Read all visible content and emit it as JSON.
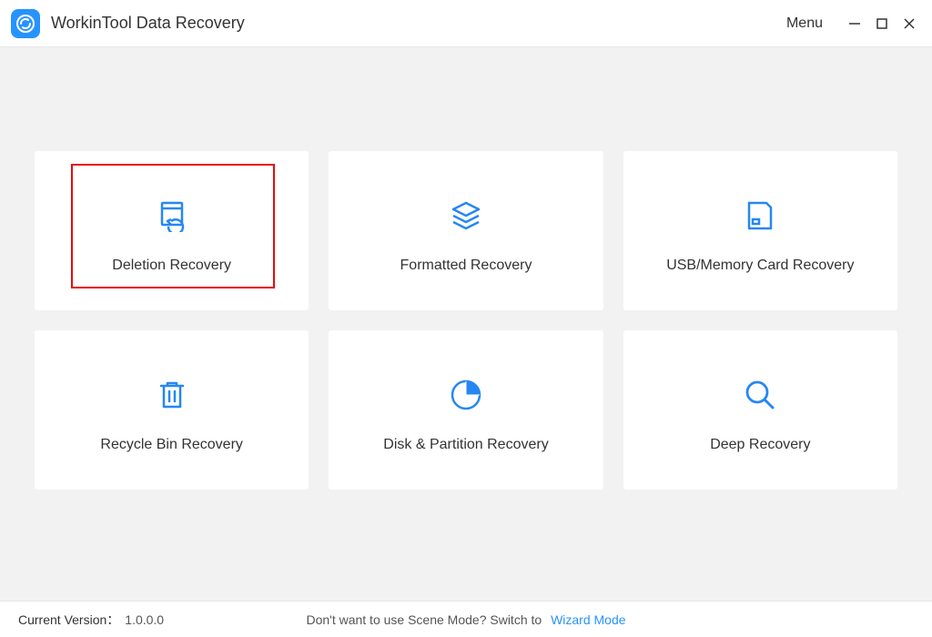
{
  "header": {
    "app_title": "WorkinTool Data Recovery",
    "menu_label": "Menu"
  },
  "cards": [
    {
      "label": "Deletion Recovery",
      "selected": true
    },
    {
      "label": "Formatted Recovery",
      "selected": false
    },
    {
      "label": "USB/Memory Card Recovery",
      "selected": false
    },
    {
      "label": "Recycle Bin Recovery",
      "selected": false
    },
    {
      "label": "Disk & Partition Recovery",
      "selected": false
    },
    {
      "label": "Deep Recovery",
      "selected": false
    }
  ],
  "footer": {
    "version_label": "Current Version：",
    "version_value": "1.0.0.0",
    "switch_text": "Don't want to use Scene Mode? Switch to",
    "switch_link": "Wizard Mode"
  }
}
